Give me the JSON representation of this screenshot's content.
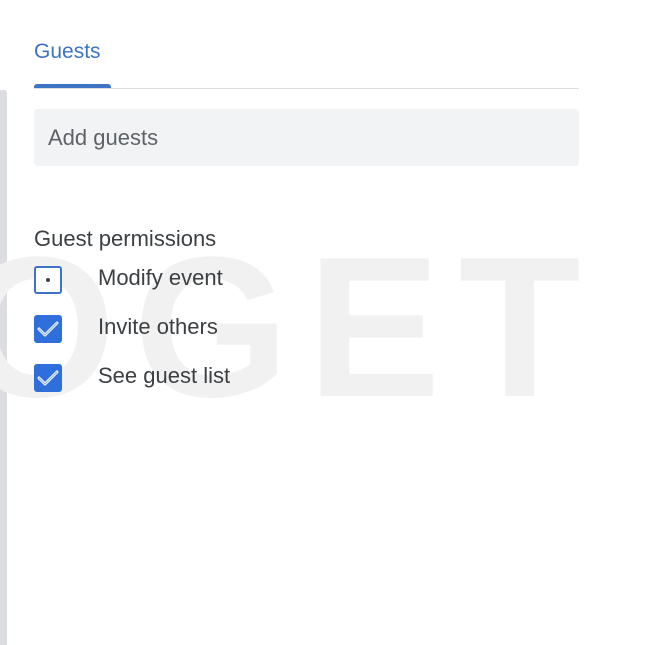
{
  "tabs": [
    {
      "label": "Guests",
      "active": true
    }
  ],
  "guest_input": {
    "value": "",
    "placeholder": "Add guests"
  },
  "permissions": {
    "title": "Guest permissions",
    "items": [
      {
        "label": "Modify event",
        "checked": false
      },
      {
        "label": "Invite others",
        "checked": true
      },
      {
        "label": "See guest list",
        "checked": true
      }
    ]
  },
  "watermark": "GADGET TIPS",
  "colors": {
    "accent": "#3d73c4",
    "checkbox_fill": "#2f6fdc",
    "input_bg": "#f1f3f4",
    "text": "#3c4043",
    "divider": "#dadce0"
  }
}
